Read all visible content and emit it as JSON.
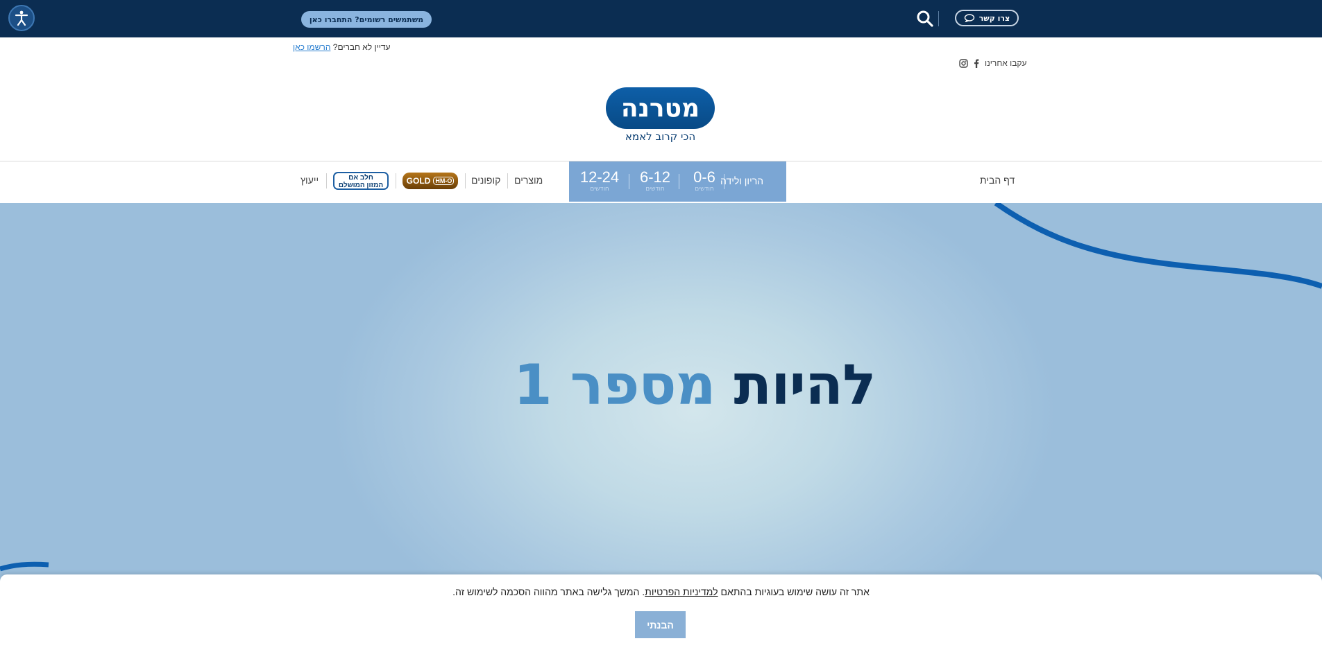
{
  "topbar": {
    "accessibility_icon": "accessibility-person-icon",
    "login_pill": "משתמשים רשומים? התחברו כאן",
    "search_icon": "search-icon",
    "contact_label": "צרו קשר",
    "contact_icon": "speech-bubble-icon"
  },
  "register": {
    "question": "עדיין לא חברים?",
    "link": "הרשמו כאן"
  },
  "follow": {
    "label": "עקבו אחרינו",
    "icons": [
      "facebook-icon",
      "instagram-icon"
    ]
  },
  "logo": {
    "name": "מטרנה",
    "tagline": "הכי קרוב לאמא"
  },
  "nav": {
    "home": "דף הבית",
    "pregnancy": "הריון ולידה",
    "ages": [
      {
        "range": "0-6",
        "unit": "חודשים"
      },
      {
        "range": "6-12",
        "unit": "חודשים"
      },
      {
        "range": "12-24",
        "unit": "חודשים"
      }
    ],
    "products": "מוצרים",
    "coupons": "קופונים",
    "gold_badge": "GOLD",
    "gold_badge_mark": "HM-O",
    "milk_badge_line1": "חלב אם",
    "milk_badge_line2": "המזון המושלם",
    "advice": "ייעוץ"
  },
  "hero": {
    "title_part1": "להיות",
    "title_part2": "מספר 1"
  },
  "cookie": {
    "text_before": "אתר זה עושה שימוש בעוגיות בהתאם",
    "link": "למדיניות הפרטיות",
    "text_after": ". המשך גלישה באתר מהווה הסכמה לשימוש זה.",
    "button": "הבנתי"
  },
  "colors": {
    "topbar": "#0b2d52",
    "accent": "#7ba6d4",
    "gold": "#9a6110",
    "hero_curve": "#0d5fb0"
  }
}
